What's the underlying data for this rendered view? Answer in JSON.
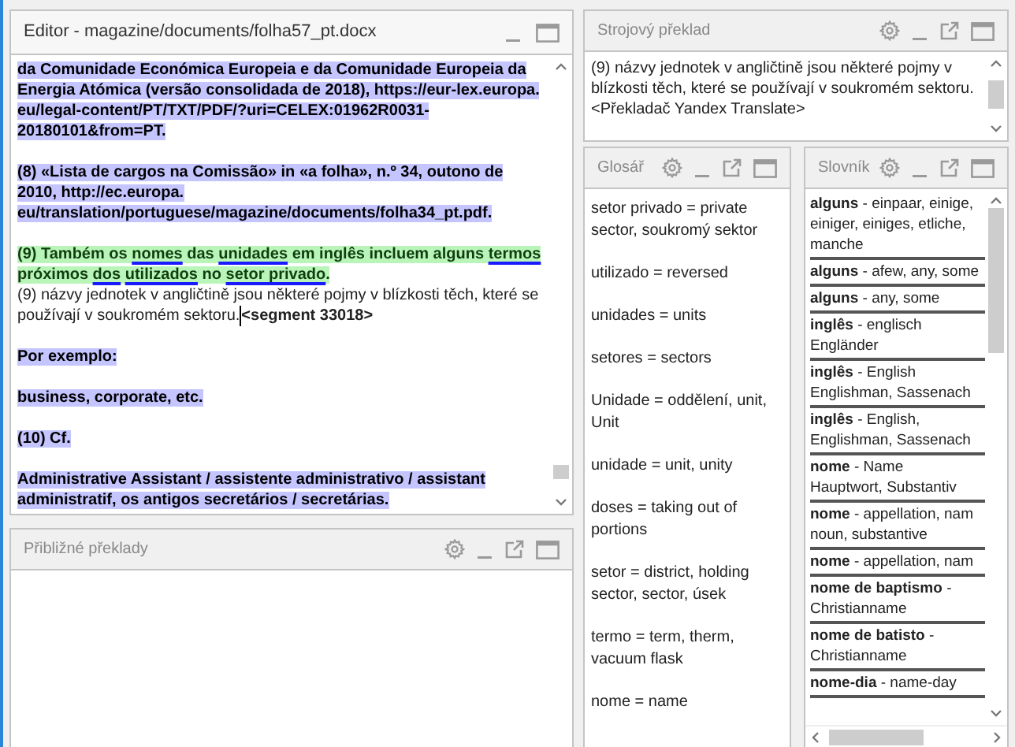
{
  "editor": {
    "title": "Editor - magazine/documents/folha57_pt.docx",
    "segments": [
      {
        "kind": "source",
        "text": "da Comunidade Económica Europeia e da Comunidade Europeia da Energia Atómica (versão consolidada de 2018), https://eur-lex.europa. eu/legal-content/PT/TXT/PDF/?uri=CELEX:01962R0031-20180101&from=PT."
      },
      {
        "kind": "source",
        "text": "(8) «Lista de cargos na Comissão» in «a folha», n.º 34, outono de 2010, http://ec.europa. eu/translation/portuguese/magazine/documents/folha34_pt.pdf."
      },
      {
        "kind": "active",
        "parts": [
          {
            "text": "(9) Também os ",
            "term": false
          },
          {
            "text": "nomes",
            "term": true
          },
          {
            "text": " das ",
            "term": false
          },
          {
            "text": "unidades",
            "term": true
          },
          {
            "text": " em inglês incluem alguns ",
            "term": false
          },
          {
            "text": "termos",
            "term": true
          },
          {
            "text": " próximos ",
            "term": false
          },
          {
            "text": "dos",
            "term": true
          },
          {
            "text": " utilizados",
            "term": true
          },
          {
            "text": " no ",
            "term": false
          },
          {
            "text": "setor privado",
            "term": true
          },
          {
            "text": ".",
            "term": false
          }
        ],
        "target": "(9) názvy jednotek v angličtině jsou některé pojmy v blízkosti těch, které se používají v soukromém sektoru.",
        "tag": "<segment 33018>"
      },
      {
        "kind": "source",
        "text": "Por exemplo:"
      },
      {
        "kind": "source",
        "text": "business, corporate, etc."
      },
      {
        "kind": "source",
        "text": "(10) Cf."
      },
      {
        "kind": "source",
        "text": "Administrative Assistant / assistente administrativo / assistant administratif, os antigos secretários / secretárias."
      }
    ]
  },
  "fuzzy": {
    "title": "Přibližné překlady"
  },
  "machine_translation": {
    "title": "Strojový překlad",
    "text": "(9) názvy jednotek v angličtině jsou některé pojmy v blízkosti těch, které se používají v soukromém sektoru.",
    "provider": "<Překladač Yandex Translate>"
  },
  "glossary": {
    "title": "Glosář",
    "entries": [
      "setor privado = private sector, soukromý sektor",
      "utilizado = reversed",
      "unidades = units",
      "setores = sectors",
      "Unidade = oddělení, unit, Unit",
      "unidade = unit, unity",
      "doses = taking out of portions",
      "setor = district, holding sector, sector, úsek",
      "termo = term, therm, vacuum flask",
      "nome = name"
    ]
  },
  "dictionary": {
    "title": "Slovník",
    "entries": [
      {
        "term": "alguns",
        "lines": [
          "- einpaar, einige,",
          "einiger, einiges, etliche,",
          "manche"
        ]
      },
      {
        "term": "alguns",
        "lines": [
          "- afew, any, some"
        ]
      },
      {
        "term": "alguns",
        "lines": [
          "- any, some"
        ]
      },
      {
        "term": "inglês",
        "lines": [
          "- englisch",
          "Engländer"
        ]
      },
      {
        "term": "inglês",
        "lines": [
          "- English",
          "Englishman, Sassenach"
        ]
      },
      {
        "term": "inglês",
        "lines": [
          "- English,",
          "Englishman, Sassenach"
        ]
      },
      {
        "term": "nome",
        "lines": [
          "- Name",
          "Hauptwort, Substantiv"
        ]
      },
      {
        "term": "nome",
        "lines": [
          "- appellation, nam",
          "noun, substantive"
        ]
      },
      {
        "term": "nome",
        "lines": [
          "- appellation, nam"
        ]
      },
      {
        "term": "nome de baptismo",
        "lines": [
          "-",
          "Christianname"
        ]
      },
      {
        "term": "nome de batisto",
        "lines": [
          "-",
          "Christianname"
        ]
      },
      {
        "term": "nome-dia",
        "lines": [
          "- name-day"
        ]
      }
    ]
  }
}
